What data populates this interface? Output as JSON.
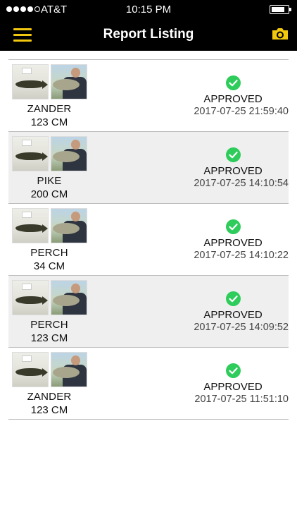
{
  "status_bar": {
    "carrier": "AT&T",
    "time": "10:15 PM",
    "signal_bars_filled": 4,
    "battery_level": 0.85
  },
  "nav": {
    "title": "Report Listing",
    "left_icon": "hamburger-menu-icon",
    "right_icon": "camera-icon",
    "accent_color": "#f2c80f"
  },
  "reports": [
    {
      "species": "ZANDER",
      "length": "123 CM",
      "status": "APPROVED",
      "timestamp": "2017-07-25 21:59:40"
    },
    {
      "species": "PIKE",
      "length": "200 CM",
      "status": "APPROVED",
      "timestamp": "2017-07-25 14:10:54"
    },
    {
      "species": "PERCH",
      "length": "34 CM",
      "status": "APPROVED",
      "timestamp": "2017-07-25 14:10:22"
    },
    {
      "species": "PERCH",
      "length": "123 CM",
      "status": "APPROVED",
      "timestamp": "2017-07-25 14:09:52"
    },
    {
      "species": "ZANDER",
      "length": "123 CM",
      "status": "APPROVED",
      "timestamp": "2017-07-25 11:51:10"
    }
  ],
  "colors": {
    "status_approved": "#2ecc5b",
    "row_alt_background": "#efefef"
  }
}
